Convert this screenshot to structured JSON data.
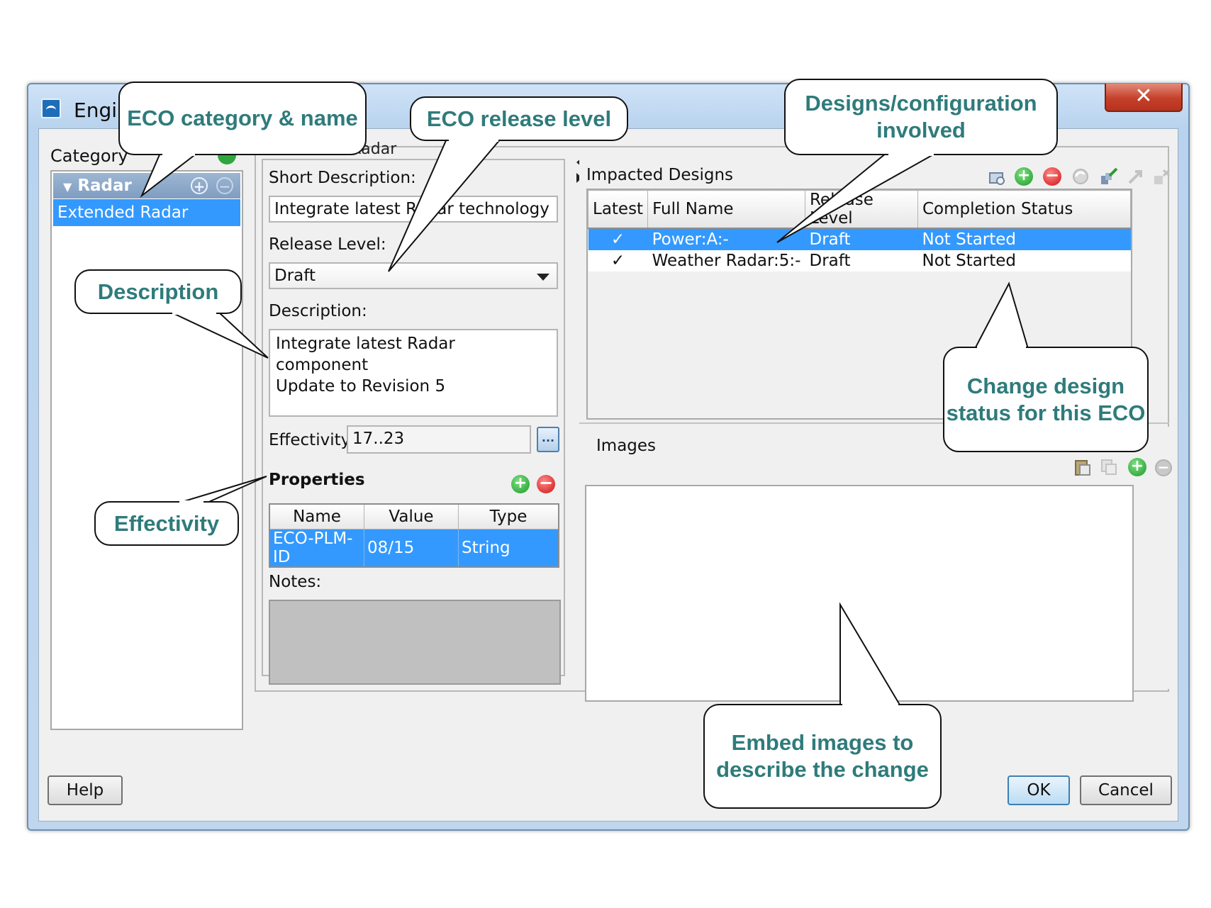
{
  "window": {
    "title": "Engir",
    "close_glyph": "✕"
  },
  "category_pane": {
    "label": "Category",
    "group": {
      "label": "Radar",
      "arrow": "▼",
      "add": "+",
      "remove": "−"
    },
    "item": "Extended Radar"
  },
  "detail": {
    "heading": "Extended Radar",
    "short_description": {
      "label": "Short Description:",
      "value": "Integrate latest Radar technology"
    },
    "release_level": {
      "label": "Release Level:",
      "value": "Draft"
    },
    "description": {
      "label": "Description:",
      "lines": [
        "Integrate latest Radar component",
        "Update to Revision 5"
      ]
    },
    "effectivity": {
      "label": "Effectivity:",
      "value": "17..23",
      "button": "..."
    },
    "properties": {
      "label": "Properties",
      "columns": [
        "Name",
        "Value",
        "Type"
      ],
      "rows": [
        [
          "ECO-PLM-ID",
          "08/15",
          "String"
        ]
      ]
    },
    "notes_label": "Notes:"
  },
  "impacted_designs": {
    "label": "Impacted Designs",
    "columns": [
      "Latest",
      "Full Name",
      "Release Level",
      "Completion Status"
    ],
    "rows": [
      {
        "latest": "✓",
        "name": "Power:A:-",
        "release": "Draft",
        "status": "Not Started",
        "selected": true
      },
      {
        "latest": "✓",
        "name": "Weather Radar:5:-",
        "release": "Draft",
        "status": "Not Started",
        "selected": false
      }
    ]
  },
  "images": {
    "label": "Images"
  },
  "buttons": {
    "help": "Help",
    "ok": "OK",
    "cancel": "Cancel"
  },
  "callouts": {
    "category": "ECO category & name",
    "release": "ECO release level",
    "designs": "Designs/configuration involved",
    "description": "Description",
    "change_status": "Change design status for this ECO",
    "effectivity": "Effectivity",
    "images": "Embed images to describe the change"
  },
  "colors": {
    "selection": "#3399ff",
    "callout_text": "#2f7b7b",
    "title_bar": "#bfd6ee",
    "close_button": "#c4402a"
  },
  "icons": {
    "category_add": "plus-circle-icon",
    "impacted_toolbar": [
      "view-design-icon",
      "add-icon",
      "remove-icon",
      "refresh-icon",
      "set-status-icon",
      "move-icon",
      "delete-link-icon"
    ],
    "images_toolbar": [
      "paste-icon",
      "copy-icon",
      "add-icon",
      "remove-icon"
    ]
  }
}
